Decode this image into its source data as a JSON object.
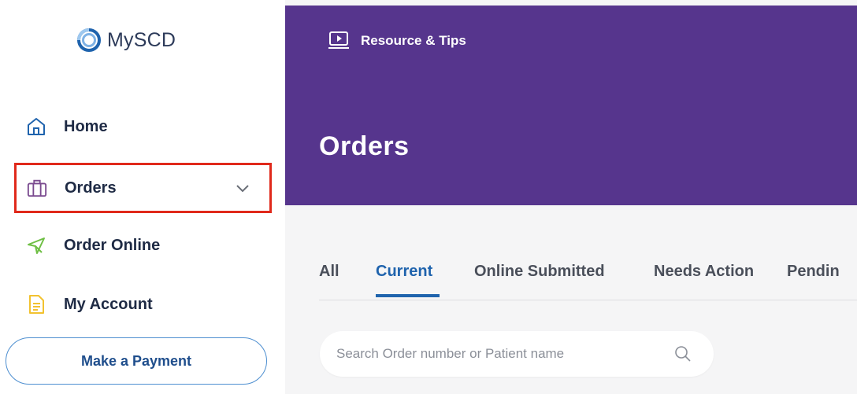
{
  "brand": {
    "name": "MySCD"
  },
  "sidebar": {
    "items": [
      {
        "label": "Home",
        "icon": "home-icon"
      },
      {
        "label": "Orders",
        "icon": "briefcase-icon",
        "selected": true
      },
      {
        "label": "Order Online",
        "icon": "cursor-arrow-icon"
      },
      {
        "label": "My Account",
        "icon": "document-icon"
      }
    ],
    "payment_label": "Make a Payment"
  },
  "header": {
    "resource_label": "Resource & Tips",
    "page_title": "Orders"
  },
  "tabs": [
    {
      "label": "All"
    },
    {
      "label": "Current",
      "active": true
    },
    {
      "label": "Online Submitted"
    },
    {
      "label": "Needs Action"
    },
    {
      "label": "Pendin"
    }
  ],
  "search": {
    "placeholder": "Search Order number or Patient name",
    "value": ""
  },
  "colors": {
    "banner": "#56358d",
    "accent": "#1f63ad",
    "highlight_border": "#e0291b",
    "order_online_icon": "#6fbf45",
    "account_icon": "#f2c230"
  }
}
